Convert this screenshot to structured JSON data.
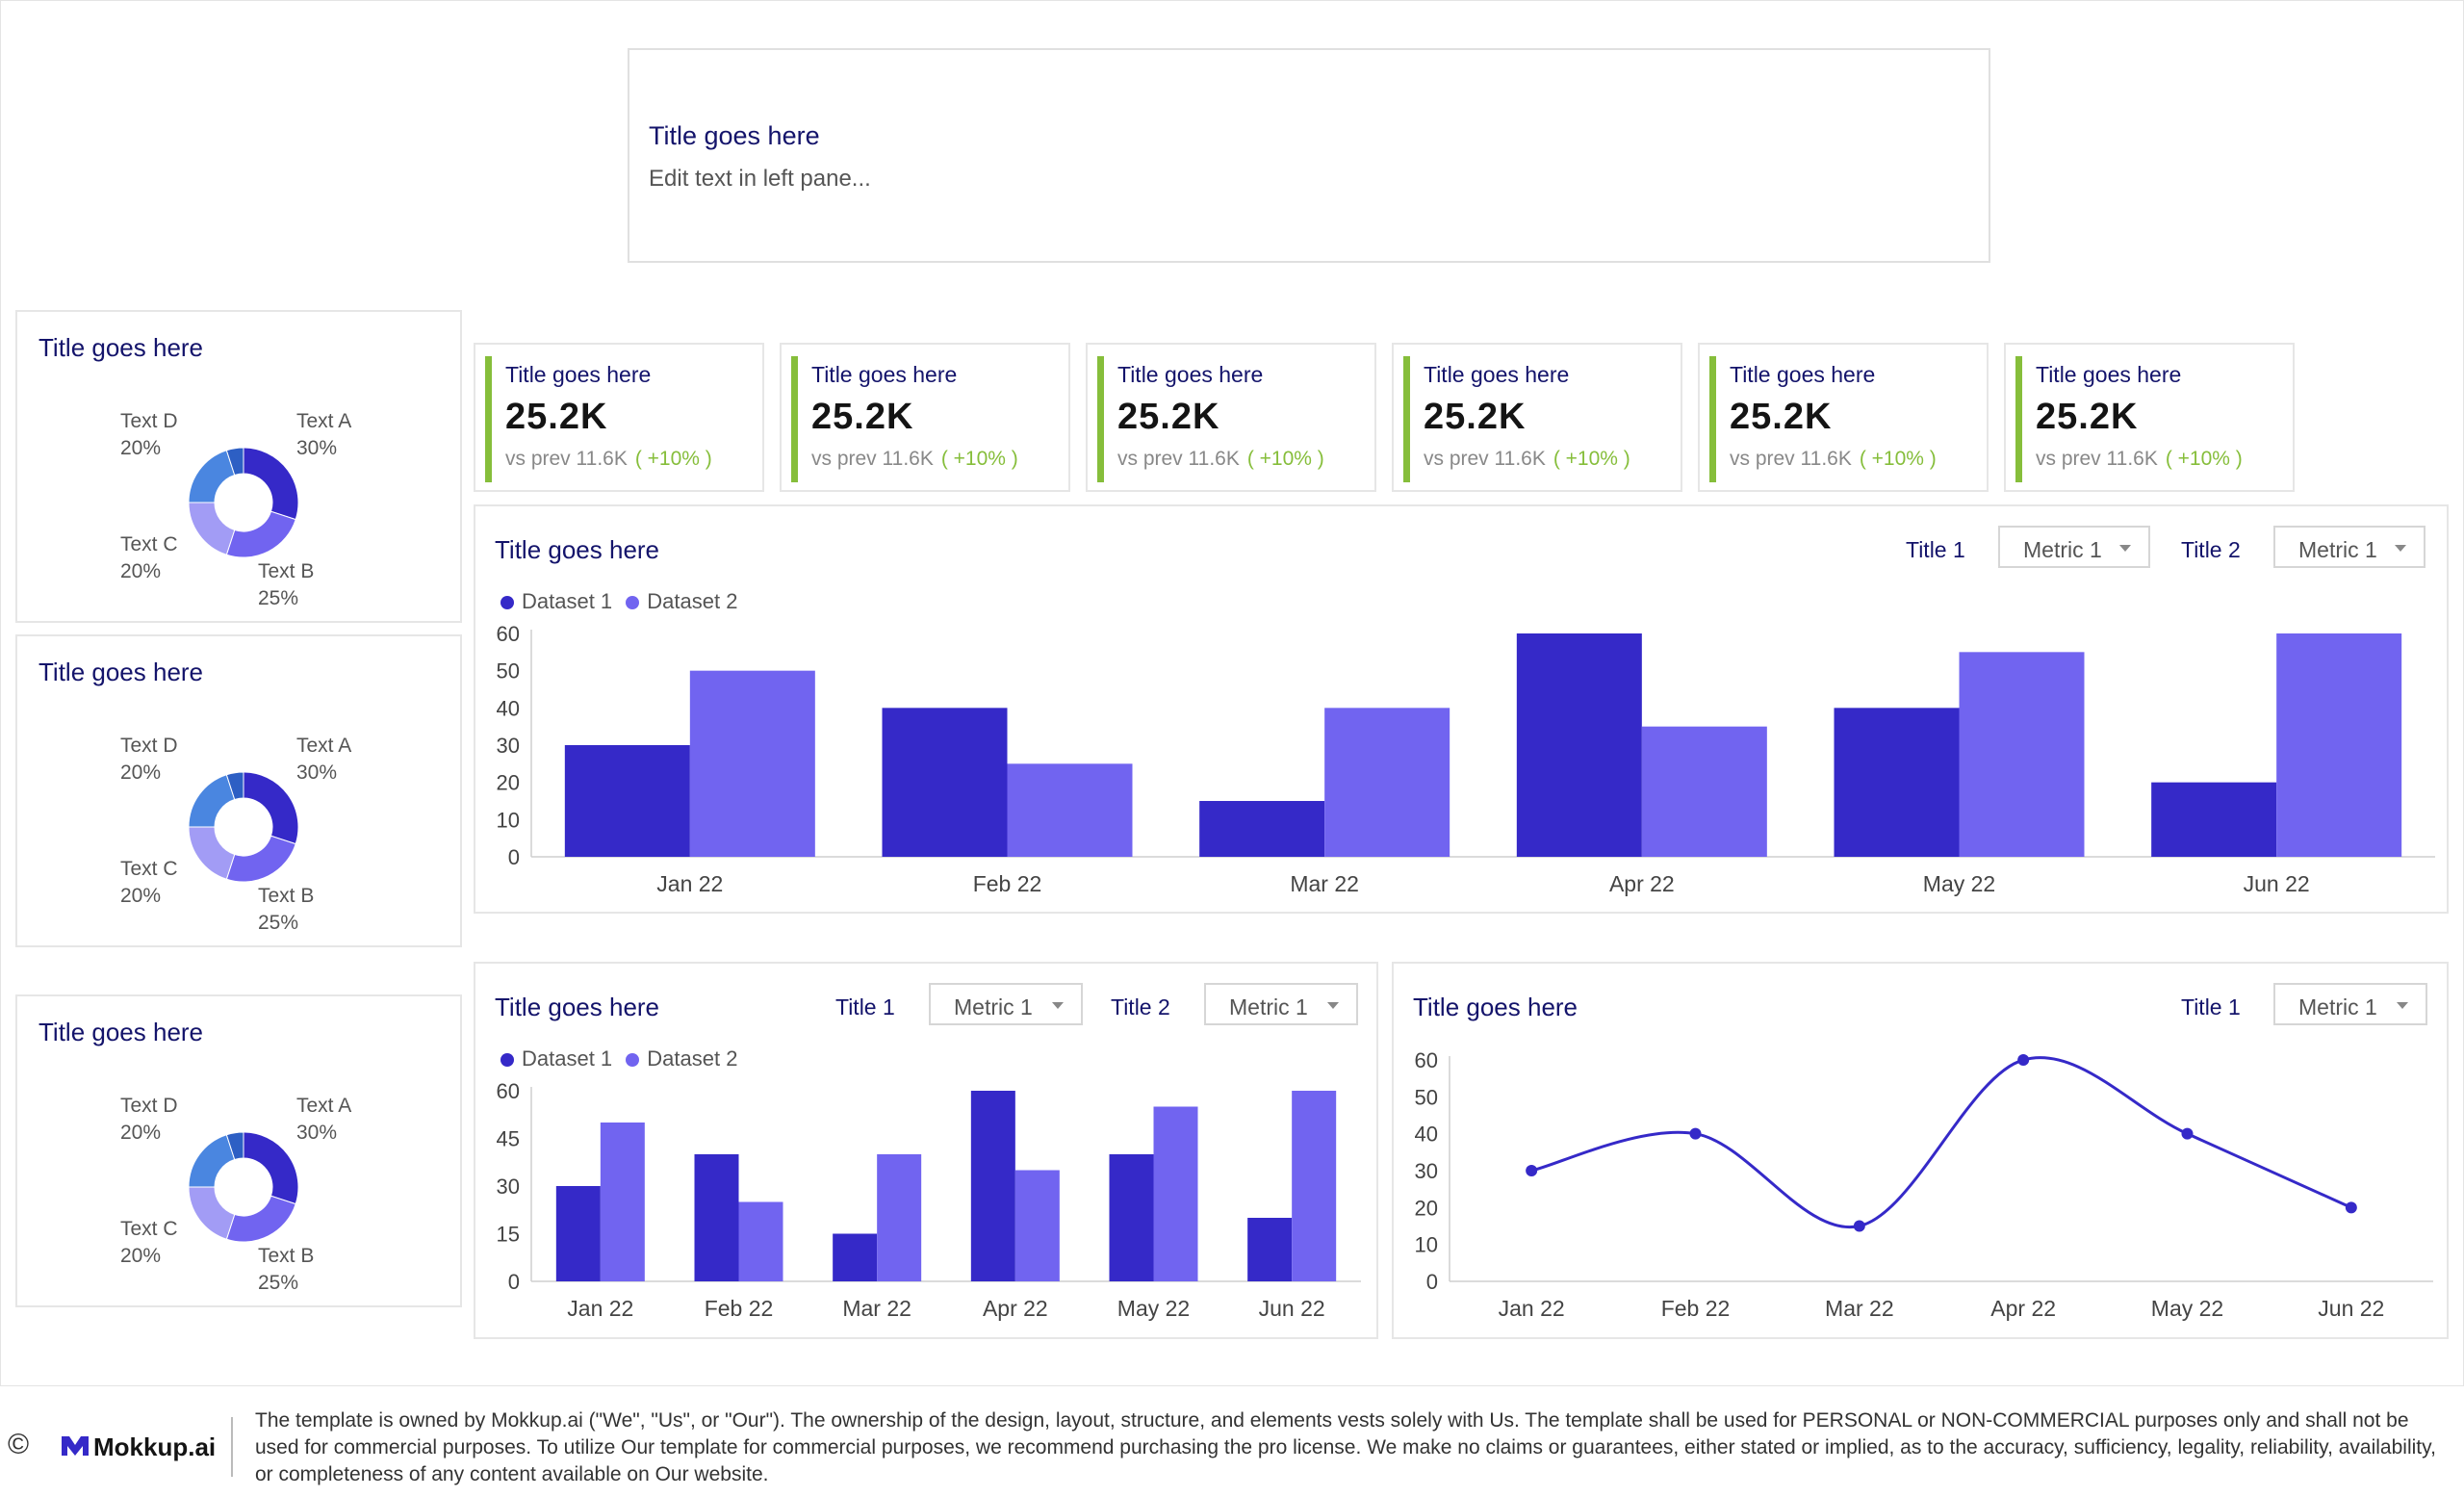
{
  "header": {
    "title": "Title goes here",
    "subtitle": "Edit text in left pane..."
  },
  "colors": {
    "dataset1": "#3529c8",
    "dataset2": "#7164f0",
    "accent_green": "#86be3b",
    "title": "#14146b"
  },
  "donuts": [
    {
      "title": "Title goes here",
      "labels": {
        "d": {
          "name": "Text D",
          "pct": "20%"
        },
        "a": {
          "name": "Text A",
          "pct": "30%"
        },
        "c": {
          "name": "Text C",
          "pct": "20%"
        },
        "b": {
          "name": "Text B",
          "pct": "25%"
        }
      }
    },
    {
      "title": "Title goes here",
      "labels": {
        "d": {
          "name": "Text D",
          "pct": "20%"
        },
        "a": {
          "name": "Text A",
          "pct": "30%"
        },
        "c": {
          "name": "Text C",
          "pct": "20%"
        },
        "b": {
          "name": "Text B",
          "pct": "25%"
        }
      }
    },
    {
      "title": "Title goes here",
      "labels": {
        "d": {
          "name": "Text D",
          "pct": "20%"
        },
        "a": {
          "name": "Text A",
          "pct": "30%"
        },
        "c": {
          "name": "Text C",
          "pct": "20%"
        },
        "b": {
          "name": "Text B",
          "pct": "25%"
        }
      }
    }
  ],
  "kpis": [
    {
      "title": "Title goes here",
      "value": "25.2K",
      "prev": "vs prev 11.6K",
      "delta": "( +10% )"
    },
    {
      "title": "Title goes here",
      "value": "25.2K",
      "prev": "vs prev 11.6K",
      "delta": "( +10% )"
    },
    {
      "title": "Title goes here",
      "value": "25.2K",
      "prev": "vs prev 11.6K",
      "delta": "( +10% )"
    },
    {
      "title": "Title goes here",
      "value": "25.2K",
      "prev": "vs prev 11.6K",
      "delta": "( +10% )"
    },
    {
      "title": "Title goes here",
      "value": "25.2K",
      "prev": "vs prev 11.6K",
      "delta": "( +10% )"
    },
    {
      "title": "Title goes here",
      "value": "25.2K",
      "prev": "vs prev 11.6K",
      "delta": "( +10% )"
    }
  ],
  "bar_main": {
    "title": "Title goes here",
    "control1_label": "Title 1",
    "control1_value": "Metric 1",
    "control2_label": "Title 2",
    "control2_value": "Metric 1",
    "legend": [
      "Dataset 1",
      "Dataset 2"
    ]
  },
  "bar_small": {
    "title": "Title goes here",
    "control1_label": "Title 1",
    "control1_value": "Metric 1",
    "control2_label": "Title 2",
    "control2_value": "Metric 1",
    "legend": [
      "Dataset 1",
      "Dataset 2"
    ]
  },
  "line_card": {
    "title": "Title goes here",
    "control1_label": "Title 1",
    "control1_value": "Metric 1"
  },
  "chart_data": [
    {
      "type": "pie",
      "categories": [
        "Text A",
        "Text B",
        "Text C",
        "Text D"
      ],
      "values": [
        30,
        25,
        20,
        20
      ],
      "labels": [
        "30%",
        "25%",
        "20%",
        "20%"
      ]
    },
    {
      "type": "bar",
      "categories": [
        "Jan 22",
        "Feb 22",
        "Mar 22",
        "Apr 22",
        "May 22",
        "Jun 22"
      ],
      "series": [
        {
          "name": "Dataset 1",
          "values": [
            30,
            40,
            15,
            60,
            40,
            20
          ]
        },
        {
          "name": "Dataset 2",
          "values": [
            50,
            25,
            40,
            35,
            55,
            60
          ]
        }
      ],
      "ylim": [
        0,
        60
      ],
      "yticks": [
        0,
        10,
        20,
        30,
        40,
        50,
        60
      ],
      "legend": "top-left"
    },
    {
      "type": "bar",
      "categories": [
        "Jan 22",
        "Feb 22",
        "Mar 22",
        "Apr 22",
        "May 22",
        "Jun 22"
      ],
      "series": [
        {
          "name": "Dataset 1",
          "values": [
            30,
            40,
            15,
            60,
            40,
            20
          ]
        },
        {
          "name": "Dataset 2",
          "values": [
            50,
            25,
            40,
            35,
            55,
            60
          ]
        }
      ],
      "ylim": [
        0,
        60
      ],
      "yticks": [
        0,
        15,
        30,
        45,
        60
      ],
      "legend": "top-left"
    },
    {
      "type": "line",
      "categories": [
        "Jan 22",
        "Feb 22",
        "Mar 22",
        "Apr 22",
        "May 22",
        "Jun 22"
      ],
      "series": [
        {
          "values": [
            30,
            40,
            15,
            60,
            40,
            20
          ]
        }
      ],
      "ylim": [
        0,
        60
      ],
      "yticks": [
        0,
        10,
        20,
        30,
        40,
        50,
        60
      ]
    }
  ],
  "footer": {
    "copyright_symbol": "©",
    "brand": "Mokkup.ai",
    "disclaimer": "The template is owned by Mokkup.ai (\"We\", \"Us\", or \"Our\"). The ownership of the design, layout, structure, and elements vests solely with Us. The template shall be used for PERSONAL or NON-COMMERCIAL purposes only and shall not be used for commercial purposes. To utilize Our template for commercial purposes, we recommend purchasing the pro license. We make no claims or guarantees, either stated or implied, as to the accuracy, sufficiency, legality, reliability, availability, or completeness of any content available on Our website."
  }
}
